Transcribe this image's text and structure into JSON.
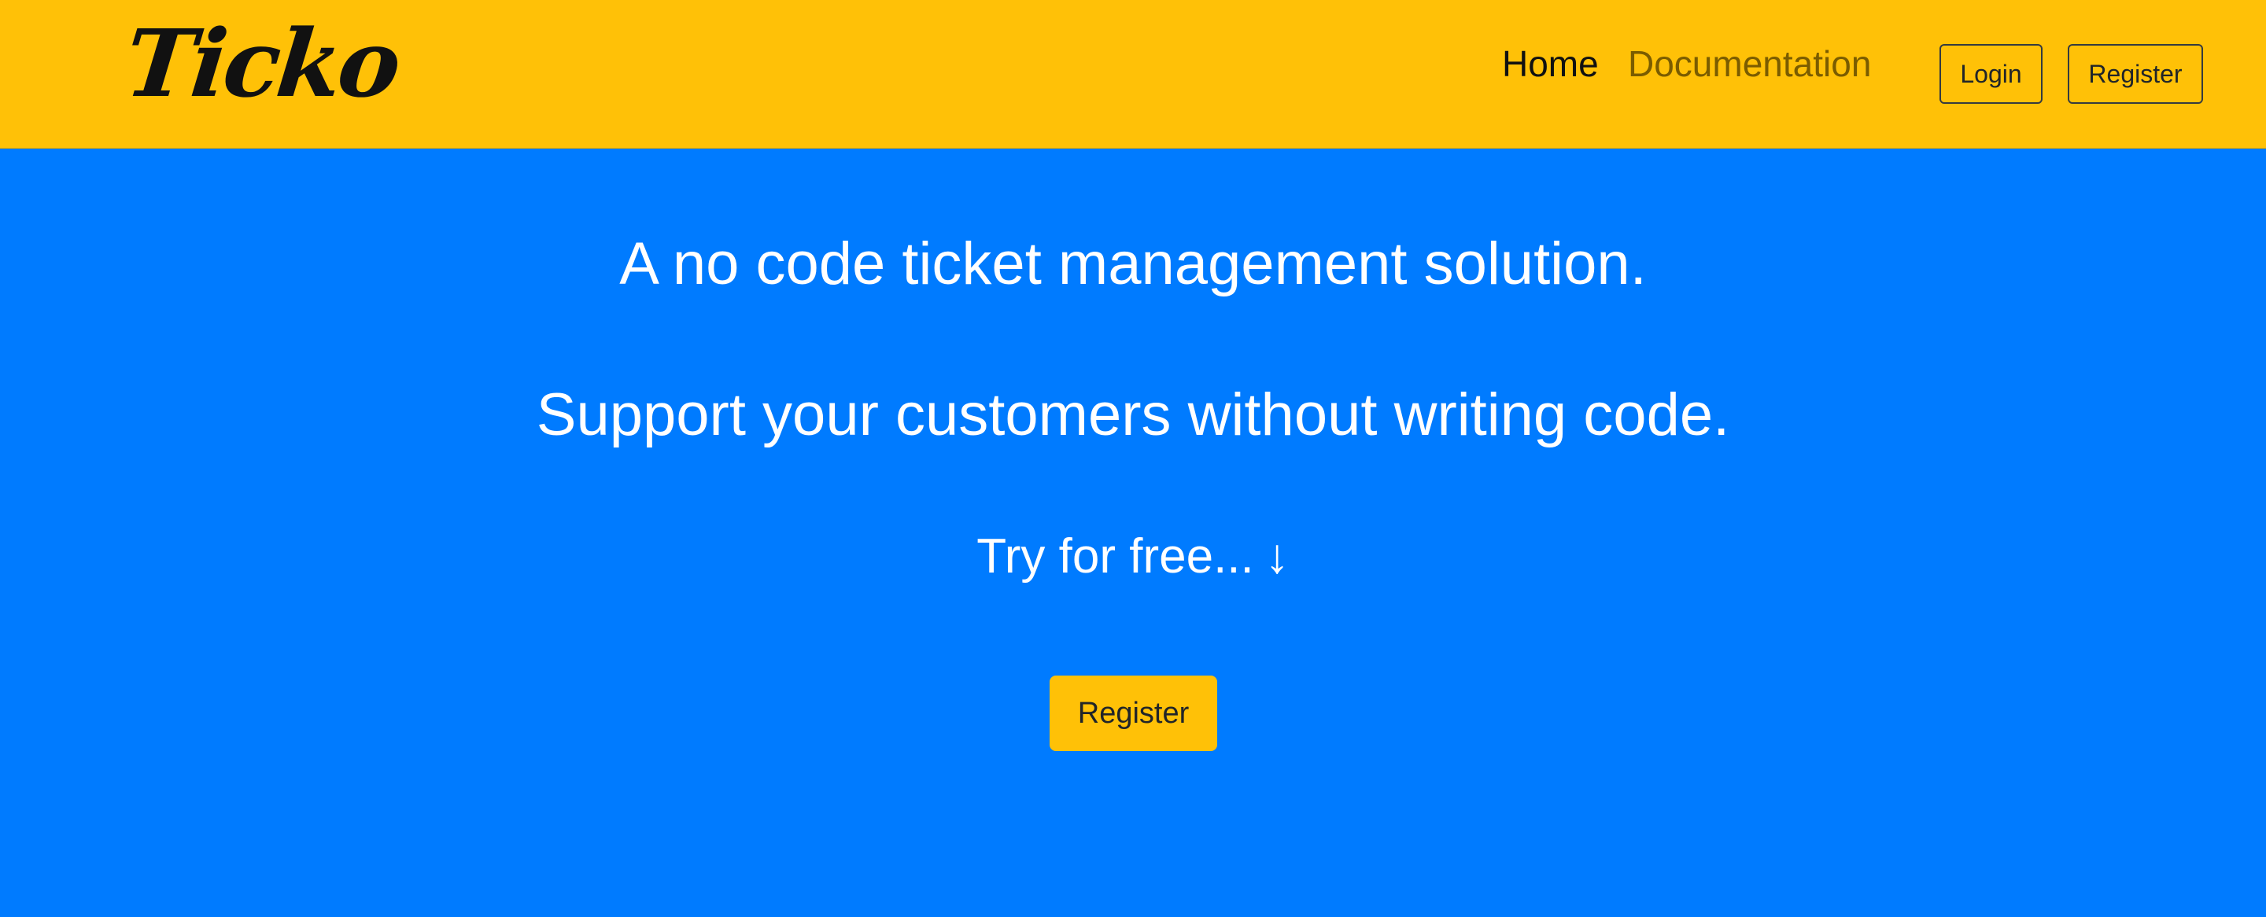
{
  "navbar": {
    "brand": "Ticko",
    "links": {
      "home": "Home",
      "documentation": "Documentation"
    },
    "buttons": {
      "login": "Login",
      "register": "Register"
    }
  },
  "hero": {
    "title": "A no code ticket management solution.",
    "subtitle": "Support your customers without writing code.",
    "cta_text": "Try for free...",
    "cta_arrow": "↓",
    "register_button": "Register"
  },
  "colors": {
    "navbar_bg": "#ffc107",
    "hero_bg": "#007bff",
    "primary_button": "#ffc107",
    "hero_text": "#ffffff"
  }
}
